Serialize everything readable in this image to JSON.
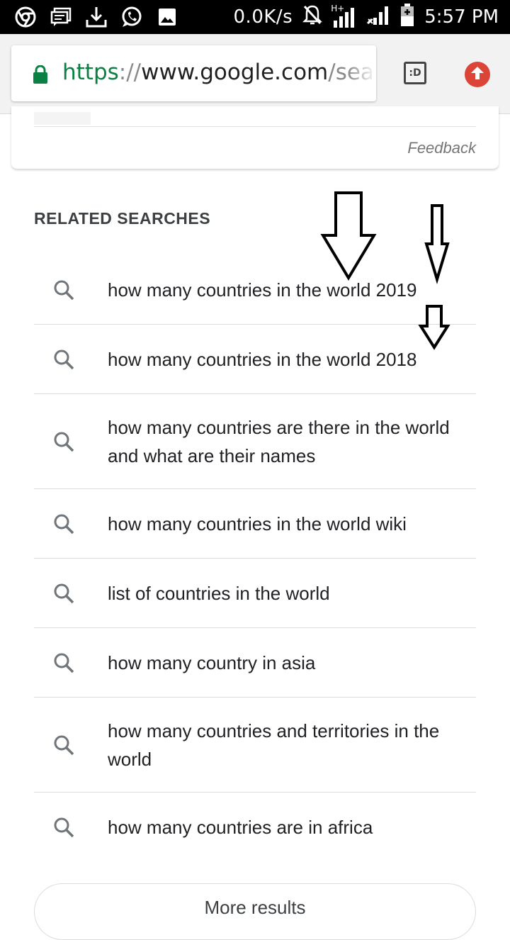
{
  "status_bar": {
    "left_icons": [
      "chrome-icon",
      "message-icon",
      "download-icon",
      "whatsapp-icon",
      "image-icon"
    ],
    "network_speed": "0.0K/s",
    "network_type": "H+",
    "time": "5:57 PM"
  },
  "browser": {
    "url_scheme": "https",
    "url_separator": "://",
    "url_host": "www.google.com",
    "url_path": "/search",
    "tab_switcher_label": ":D",
    "colors": {
      "secure": "#0b8043",
      "update": "#db4437"
    }
  },
  "card": {
    "feedback_label": "Feedback"
  },
  "related_searches": {
    "title": "RELATED SEARCHES",
    "items": [
      {
        "text": "how many countries in the world 2019"
      },
      {
        "text": "how many countries in the world 2018"
      },
      {
        "text": "how many countries are there in the world and what are their names"
      },
      {
        "text": "how many countries in the world wiki"
      },
      {
        "text": "list of countries in the world"
      },
      {
        "text": "how many country in asia"
      },
      {
        "text": "how many countries and territories in the world"
      },
      {
        "text": "how many countries are in africa"
      }
    ]
  },
  "more_results_label": "More results"
}
